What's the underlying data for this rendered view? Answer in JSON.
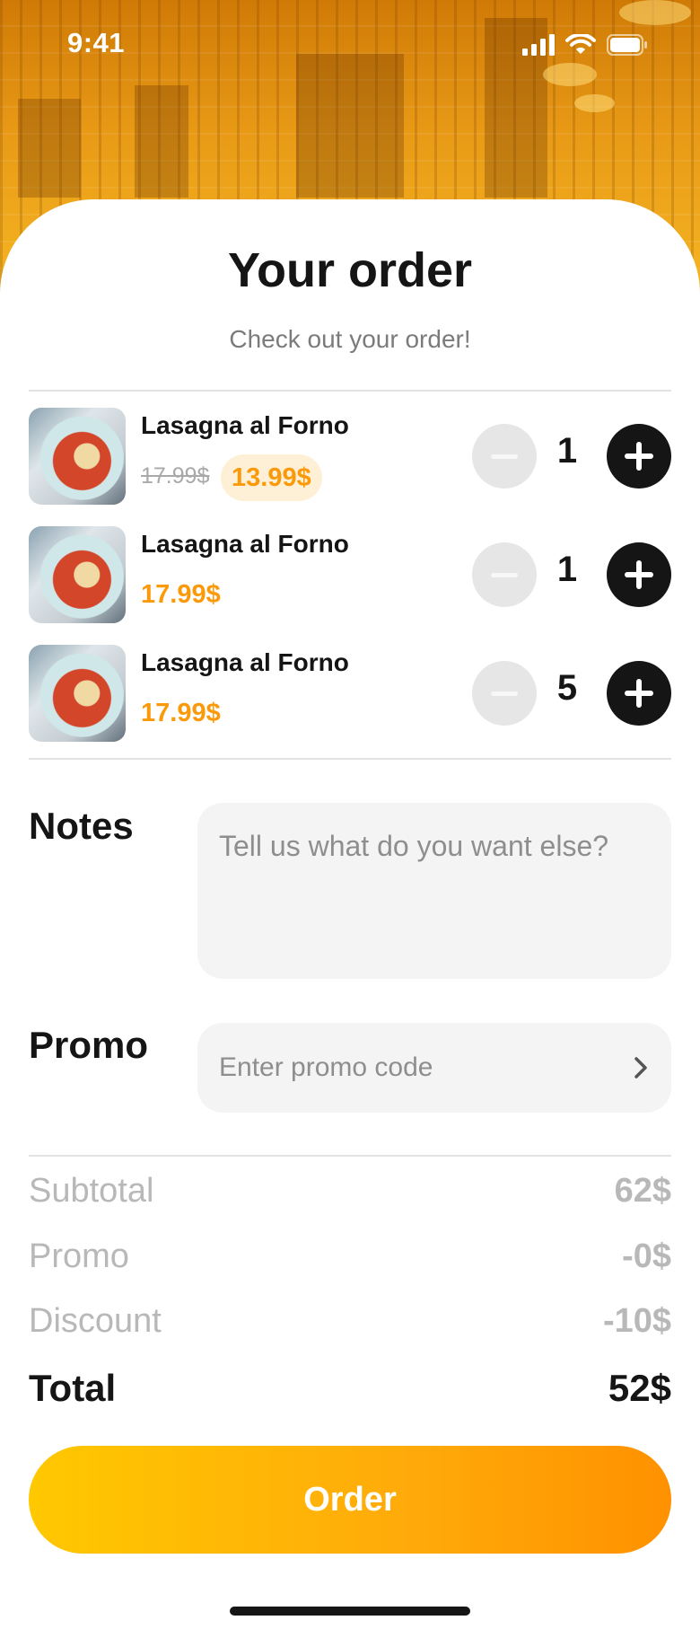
{
  "status_bar": {
    "time": "9:41"
  },
  "header": {
    "title": "Your order",
    "subtitle": "Check out your order!"
  },
  "items": [
    {
      "name": "Lasagna al Forno",
      "old_price": "17.99$",
      "price": "13.99$",
      "on_sale": true,
      "quantity": "1"
    },
    {
      "name": "Lasagna al Forno",
      "price": "17.99$",
      "on_sale": false,
      "quantity": "1"
    },
    {
      "name": "Lasagna al Forno",
      "price": "17.99$",
      "on_sale": false,
      "quantity": "5"
    }
  ],
  "notes": {
    "label": "Notes",
    "placeholder": "Tell us what do you want else?"
  },
  "promo": {
    "label": "Promo",
    "placeholder": "Enter promo code"
  },
  "summary": {
    "subtotal_label": "Subtotal",
    "subtotal_value": "62$",
    "promo_label": "Promo",
    "promo_value": "-0$",
    "discount_label": "Discount",
    "discount_value": "-10$",
    "total_label": "Total",
    "total_value": "52$"
  },
  "order_button": {
    "label": "Order"
  },
  "colors": {
    "accent": "#fa9a0a",
    "button_start": "#ffc800",
    "button_end": "#ff9100",
    "dark": "#151515"
  },
  "icons": [
    "signal-icon",
    "wifi-icon",
    "battery-icon",
    "minus-icon",
    "plus-icon",
    "chevron-right-icon"
  ]
}
